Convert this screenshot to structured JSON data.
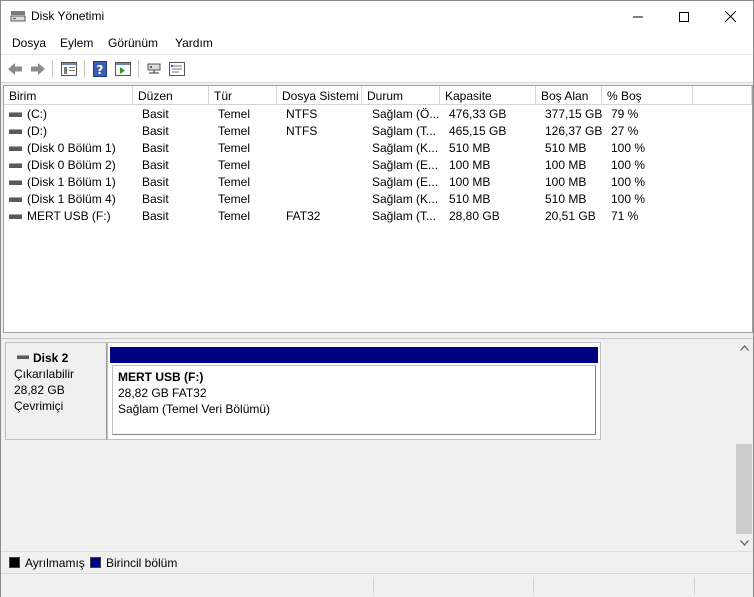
{
  "window": {
    "title": "Disk Yönetimi"
  },
  "menu": [
    "Dosya",
    "Eylem",
    "Görünüm",
    "Yardım"
  ],
  "toolbar": {
    "icons": [
      "back-arrow-icon",
      "forward-arrow-icon",
      "disk-list-icon",
      "help-icon",
      "console-icon",
      "connect-icon",
      "properties-icon"
    ]
  },
  "volumes": {
    "columns": [
      "Birim",
      "Düzen",
      "Tür",
      "Dosya Sistemi",
      "Durum",
      "Kapasite",
      "Boş Alan",
      "% Boş"
    ],
    "rows": [
      [
        "(C:)",
        "Basit",
        "Temel",
        "NTFS",
        "Sağlam (Ö...",
        "476,33 GB",
        "377,15 GB",
        "79 %"
      ],
      [
        "(D:)",
        "Basit",
        "Temel",
        "NTFS",
        "Sağlam (T...",
        "465,15 GB",
        "126,37 GB",
        "27 %"
      ],
      [
        "(Disk 0 Bölüm 1)",
        "Basit",
        "Temel",
        "",
        "Sağlam (K...",
        "510 MB",
        "510 MB",
        "100 %"
      ],
      [
        "(Disk 0 Bölüm 2)",
        "Basit",
        "Temel",
        "",
        "Sağlam (E...",
        "100 MB",
        "100 MB",
        "100 %"
      ],
      [
        "(Disk 1 Bölüm 1)",
        "Basit",
        "Temel",
        "",
        "Sağlam (E...",
        "100 MB",
        "100 MB",
        "100 %"
      ],
      [
        "(Disk 1 Bölüm 4)",
        "Basit",
        "Temel",
        "",
        "Sağlam (K...",
        "510 MB",
        "510 MB",
        "100 %"
      ],
      [
        "MERT USB (F:)",
        "Basit",
        "Temel",
        "FAT32",
        "Sağlam (T...",
        "28,80 GB",
        "20,51 GB",
        "71 %"
      ]
    ]
  },
  "disk": {
    "name": "Disk 2",
    "type": "Çıkarılabilir",
    "size": "28,82 GB",
    "status": "Çevrimiçi",
    "partition": {
      "name": "MERT USB  (F:)",
      "size_fs": "28,82 GB FAT32",
      "status": "Sağlam (Temel Veri Bölümü)",
      "color": "#000080"
    }
  },
  "legend": [
    {
      "label": "Ayrılmamış",
      "color": "#000000"
    },
    {
      "label": "Birincil bölüm",
      "color": "#000080"
    }
  ]
}
